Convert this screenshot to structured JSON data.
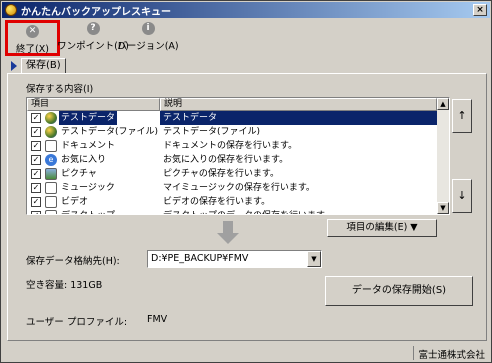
{
  "window": {
    "title": "かんたんバックアップレスキュー",
    "close_glyph": "×"
  },
  "toolbar": {
    "exit": {
      "label": "終了(X)",
      "icon": "close-circle-icon"
    },
    "onepoint": {
      "label": "ワンポイント(D)",
      "icon": "question-circle-icon"
    },
    "version": {
      "label": "バージョン(A)",
      "icon": "info-circle-icon"
    }
  },
  "tab": {
    "label": "保存(B)"
  },
  "section_label": "保存する内容(I)",
  "list": {
    "columns": [
      "項目",
      "説明"
    ],
    "rows": [
      {
        "item": "テストデータ",
        "desc": "テストデータ",
        "checked": true,
        "icon": "globe"
      },
      {
        "item": "テストデータ(ファイル)",
        "desc": "テストデータ(ファイル)",
        "checked": true,
        "icon": "globe"
      },
      {
        "item": "ドキュメント",
        "desc": "ドキュメントの保存を行います。",
        "checked": true,
        "icon": "doc"
      },
      {
        "item": "お気に入り",
        "desc": "お気に入りの保存を行います。",
        "checked": true,
        "icon": "ie"
      },
      {
        "item": "ピクチャ",
        "desc": "ピクチャの保存を行います。",
        "checked": true,
        "icon": "pic"
      },
      {
        "item": "ミュージック",
        "desc": "マイミュージックの保存を行います。",
        "checked": true,
        "icon": "doc"
      },
      {
        "item": "ビデオ",
        "desc": "ビデオの保存を行います。",
        "checked": true,
        "icon": "doc"
      },
      {
        "item": "デスクトップ",
        "desc": "デスクトップのデータの保存を行います。",
        "checked": true,
        "icon": "doc"
      }
    ],
    "selected_index": 0
  },
  "move_up": "↑",
  "move_down": "↓",
  "edit_button": "項目の編集(E) ▼",
  "destination": {
    "label": "保存データ格納先(H):",
    "value": "D:¥PE_BACKUP¥FMV"
  },
  "free_space": "空き容量: 131GB",
  "start_button": "データの保存開始(S)",
  "profile": {
    "label": "ユーザー プロファイル:",
    "value": "FMV"
  },
  "status": {
    "company": "富士通株式会社"
  }
}
